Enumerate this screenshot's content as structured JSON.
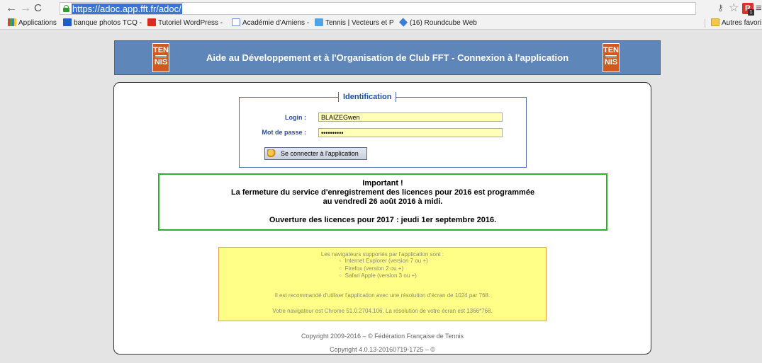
{
  "browser": {
    "url": "https://adoc.app.fft.fr/adoc/",
    "bookmarks": {
      "apps": "Applications",
      "photos": "banque photos TCQ -",
      "wordpress": "Tutoriel WordPress -",
      "academie": "Académie d'Amiens -",
      "tennis": "Tennis | Vecteurs et P",
      "roundcube": "(16) Roundcube Web",
      "other": "Autres favori"
    },
    "ext_badge": "1"
  },
  "banner": {
    "title": "Aide au Développement et à l'Organisation de Club FFT - Connexion à l'application",
    "logo_top": "TEN",
    "logo_bottom": "NIS"
  },
  "login": {
    "legend": "Identification",
    "login_label": "Login :",
    "login_value": "BLAIZEGwen",
    "password_label": "Mot de passe :",
    "password_value": "••••••••••",
    "connect_button": "Se connecter à l'application"
  },
  "notice": {
    "line1": "Important !",
    "line2": "La fermeture du service d'enregistrement des licences pour 2016 est programmée",
    "line3": "au vendredi 26 août 2016 à midi.",
    "line4": "Ouverture des licences pour 2017 : jeudi 1er septembre 2016."
  },
  "browsers": {
    "title": "Les navigateurs supportés par l'application sont :",
    "items": [
      "Internet Explorer (version 7 ou +)",
      "Firefox (version 2 ou +)",
      "Safari Apple (version 3 ou +)"
    ],
    "recommendation": "Il est recommandé d'utiliser l'application avec une résolution d'écran de 1024 par 768.",
    "current": "Votre navigateur est Chrome 51.0.2704.106. La résolution de votre écran est 1366*768."
  },
  "copyright": {
    "line1": "Copyright 2009-2016 – © Fédération Française de Tennis",
    "line2": "Copyright 4.0.13-20160719-1725 – ©"
  }
}
